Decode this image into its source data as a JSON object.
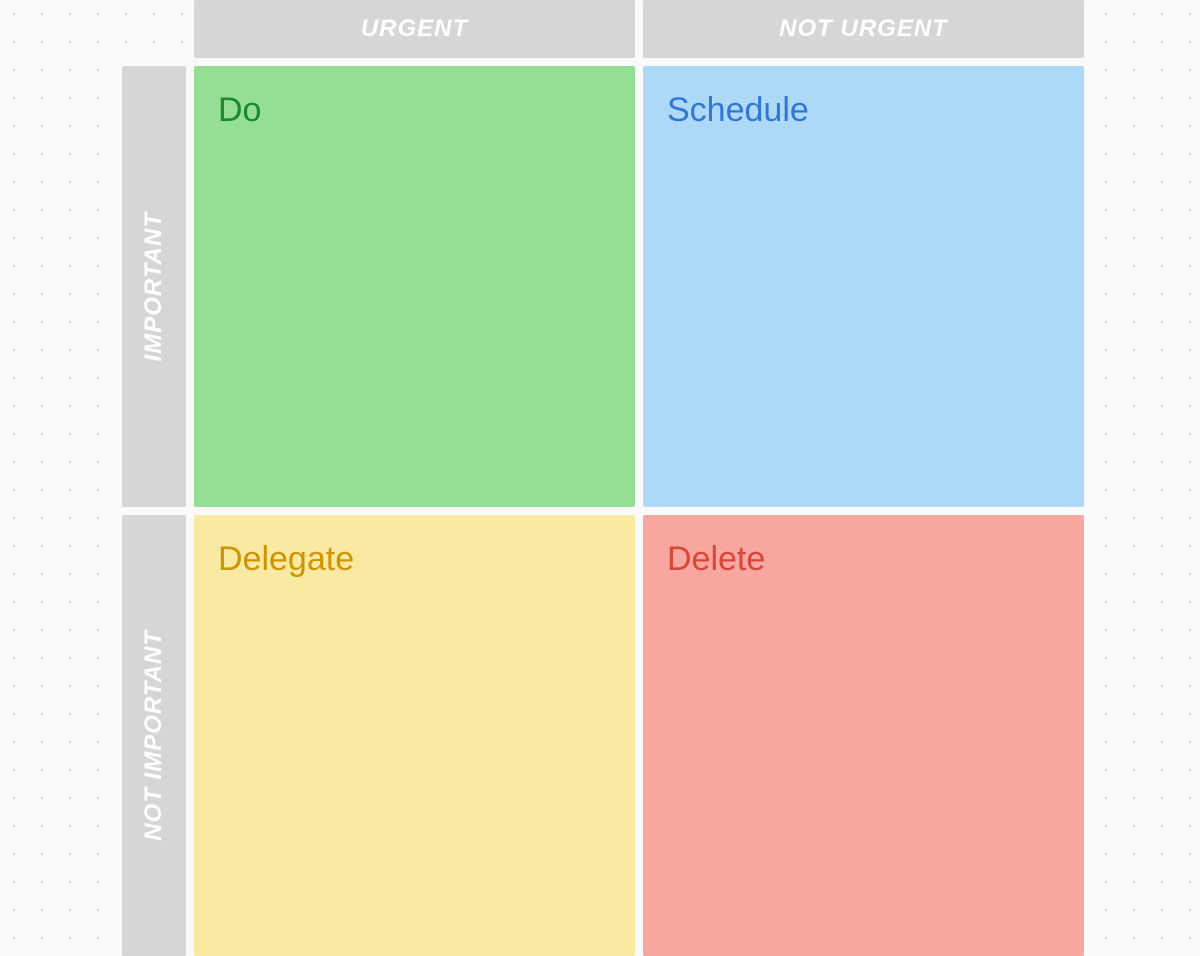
{
  "axes": {
    "columns": [
      "URGENT",
      "NOT URGENT"
    ],
    "rows": [
      "IMPORTANT",
      "NOT IMPORTANT"
    ]
  },
  "quadrants": {
    "do": {
      "title": "Do",
      "bg": "#94df95",
      "fg": "#1b8a2f"
    },
    "schedule": {
      "title": "Schedule",
      "bg": "#aed9f6",
      "fg": "#3077d6"
    },
    "delegate": {
      "title": "Delegate",
      "bg": "#f9e9a1",
      "fg": "#cf9500"
    },
    "delete": {
      "title": "Delete",
      "bg": "#f7a6a0",
      "fg": "#d9473b"
    }
  }
}
